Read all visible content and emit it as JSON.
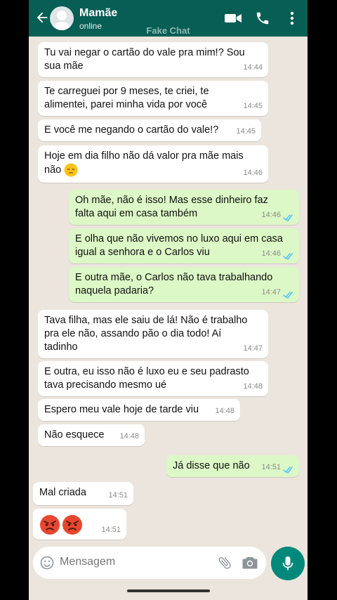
{
  "header": {
    "contact_name": "Mamãe",
    "status": "online",
    "watermark": "Fake Chat"
  },
  "messages": [
    {
      "dir": "in",
      "lines": [
        "Tu vai negar o cartão do vale pra mim!? Sou",
        "sua mãe"
      ],
      "time": "14:44"
    },
    {
      "dir": "in",
      "lines": [
        "Te carreguei por 9 meses, te criei, te",
        "alimentei, parei minha vida por você"
      ],
      "time": "14:45"
    },
    {
      "dir": "in",
      "lines": [
        "E você me negando o cartão do vale!?"
      ],
      "time": "14:45"
    },
    {
      "dir": "in",
      "lines": [
        "Hoje em dia filho não dá valor pra mãe mais",
        "não"
      ],
      "emoji": "pensive-face",
      "time": "14:46"
    },
    {
      "dir": "out",
      "lines": [
        "Oh mãe, não é isso! Mas esse dinheiro faz",
        "falta aqui em casa também"
      ],
      "time": "14:46"
    },
    {
      "dir": "out",
      "lines": [
        "E olha que não vivemos no luxo aqui em casa",
        "igual a senhora e o Carlos viu"
      ],
      "time": "14:46"
    },
    {
      "dir": "out",
      "lines": [
        "E outra mãe, o Carlos não tava trabalhando",
        "naquela padaria?"
      ],
      "time": "14:47"
    },
    {
      "dir": "in",
      "lines": [
        "Tava filha, mas ele saiu de lá! Não é trabalho",
        "pra ele não, assando pão o dia todo! Aí",
        "tadinho"
      ],
      "time": "14:47"
    },
    {
      "dir": "in",
      "lines": [
        "E outra, eu isso não é luxo eu e seu padrasto",
        "tava precisando mesmo ué"
      ],
      "time": "14:48"
    },
    {
      "dir": "in",
      "lines": [
        "Espero meu vale hoje de tarde viu"
      ],
      "time": "14:48"
    },
    {
      "dir": "in",
      "lines": [
        "Não esquece"
      ],
      "time": "14:48"
    },
    {
      "dir": "out",
      "lines": [
        "Já disse que não"
      ],
      "time": "14:51"
    },
    {
      "dir": "in",
      "lines": [
        "Mal criada"
      ],
      "time": "14:51"
    },
    {
      "dir": "in",
      "lines": [],
      "emojis": [
        "angry-face",
        "angry-face"
      ],
      "time": "14:51"
    }
  ],
  "composer": {
    "placeholder": "Mensagem"
  },
  "colors": {
    "header": "#075e54",
    "chat_bg": "#ece5dd",
    "outgoing": "#dcf8c6",
    "incoming": "#ffffff",
    "read_ticks": "#4fc3f7",
    "mic_button": "#00897b"
  }
}
